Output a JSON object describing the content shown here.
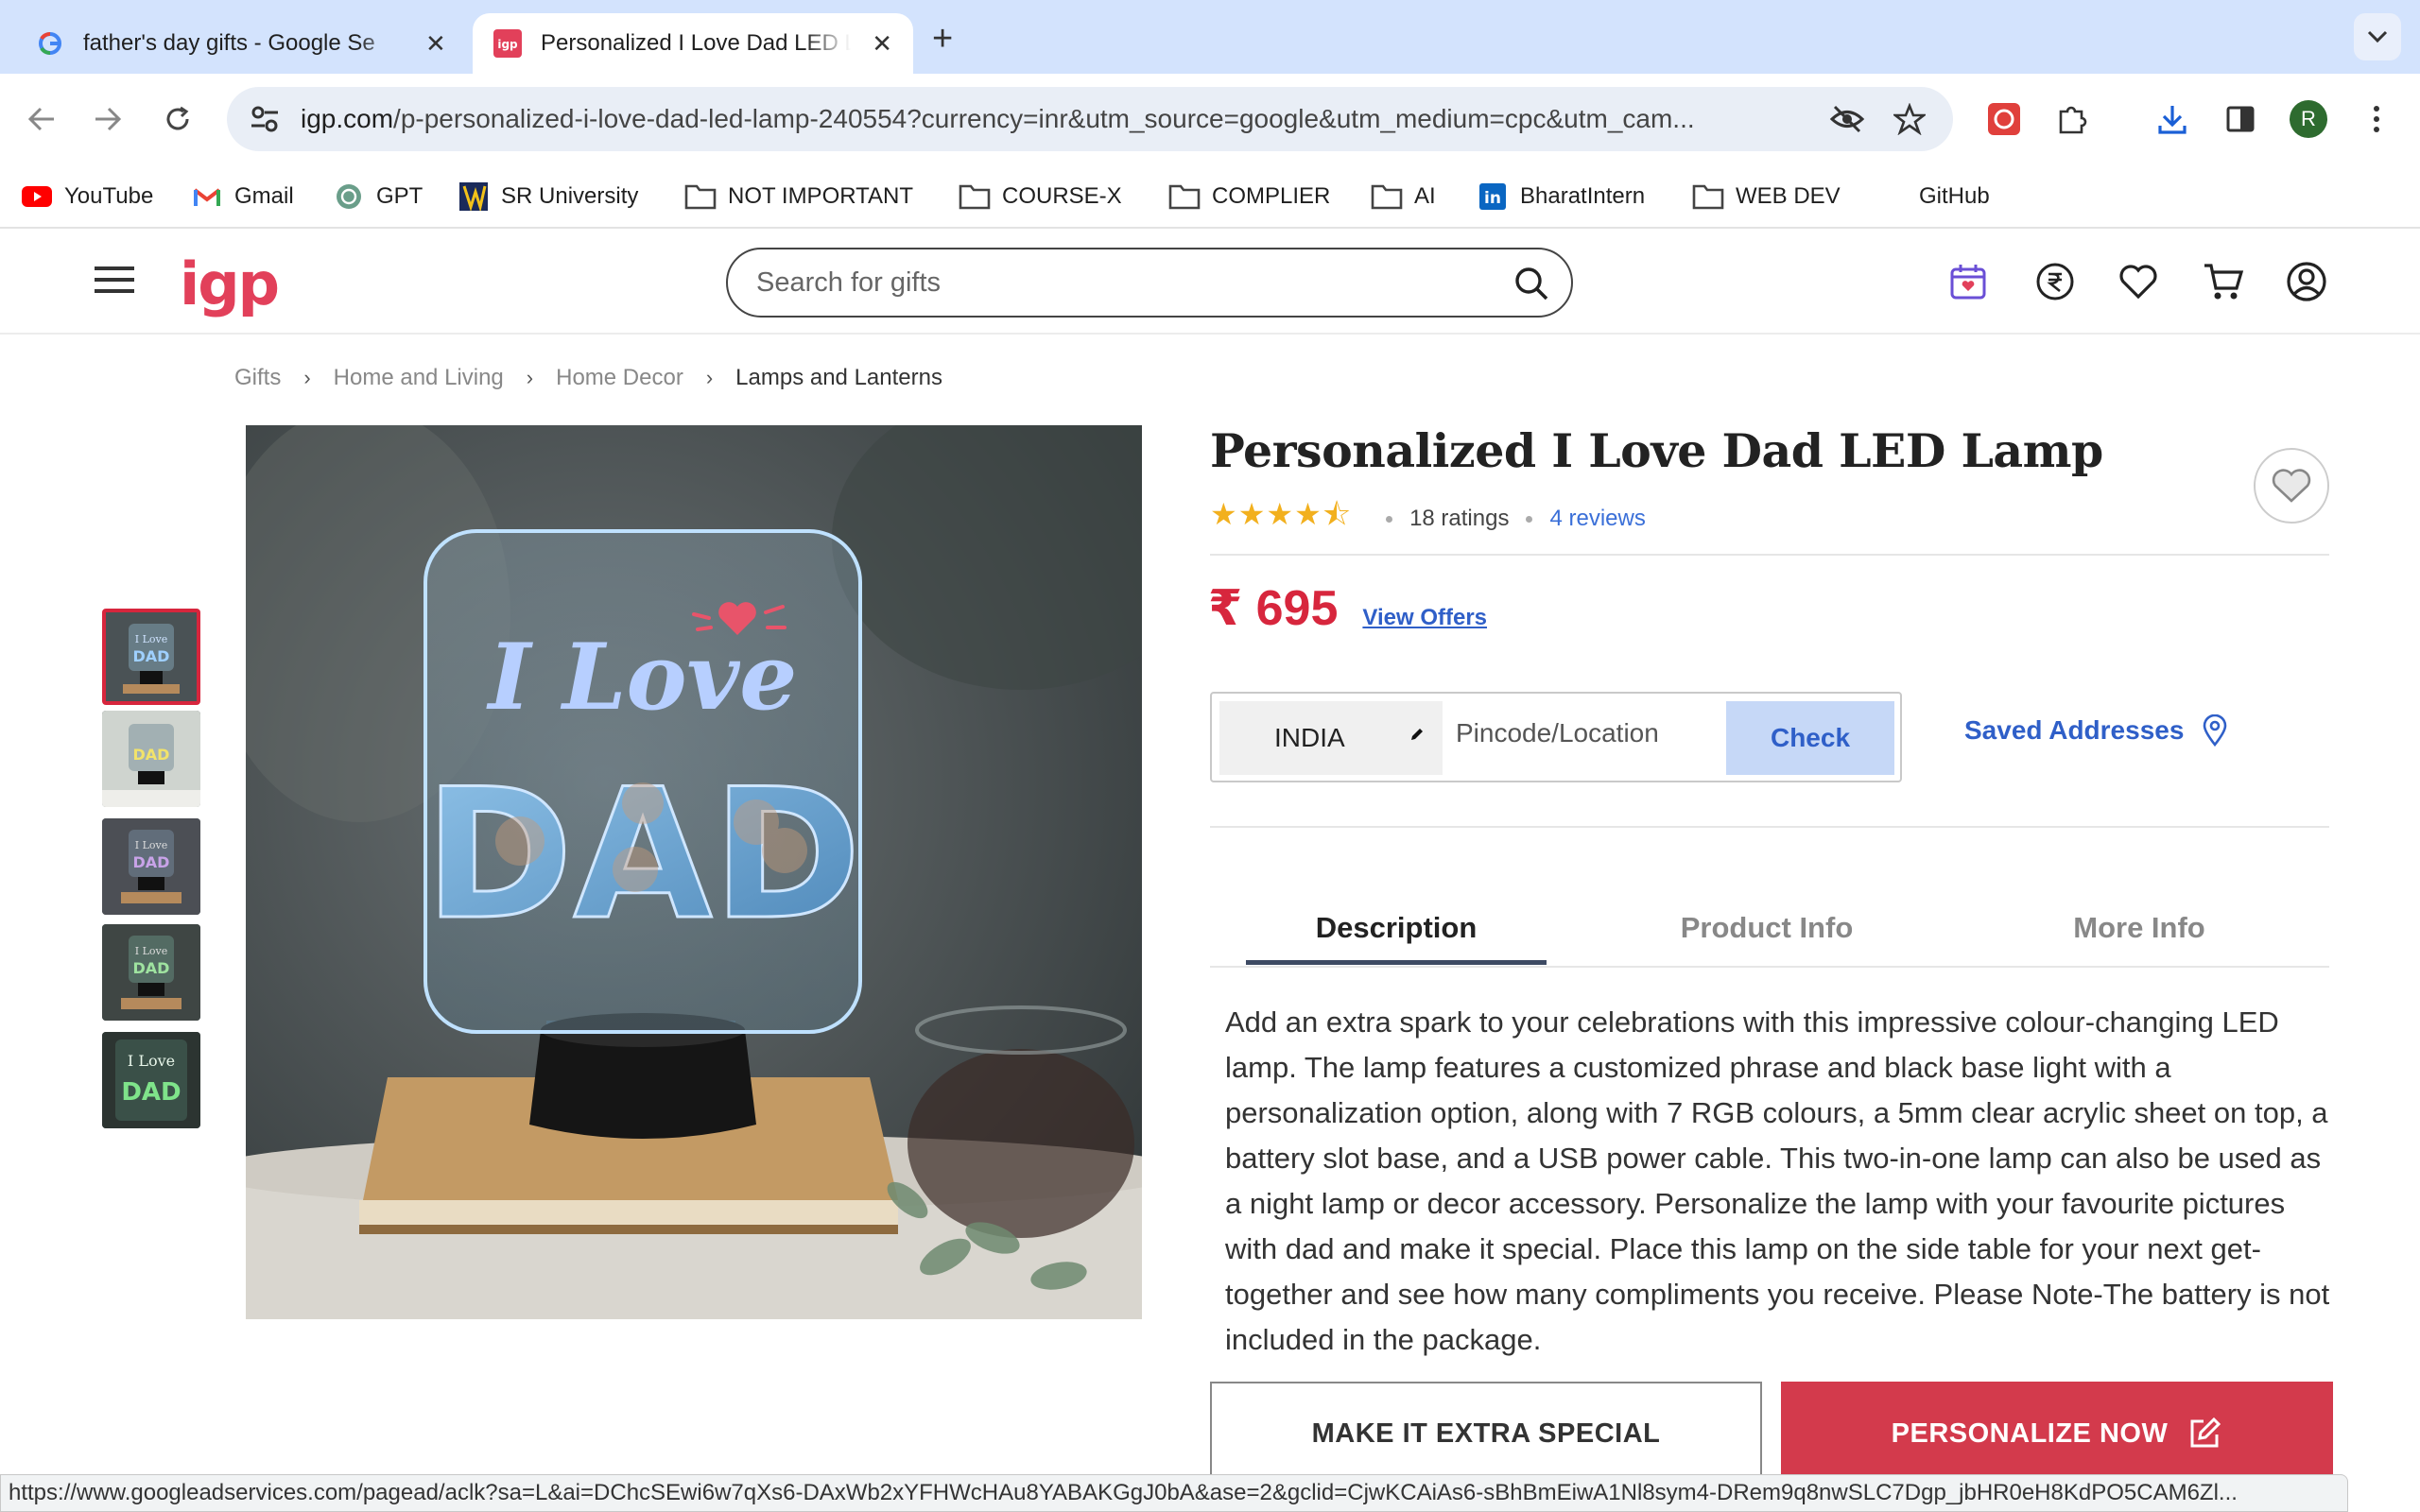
{
  "browser": {
    "tabs": [
      {
        "title": "father's day gifts - Google Se",
        "active": false
      },
      {
        "title": "Personalized I Love Dad LED L",
        "active": true
      }
    ],
    "url_host": "igp.com",
    "url_path": "/p-personalized-i-love-dad-led-lamp-240554?currency=inr&utm_source=google&utm_medium=cpc&utm_cam...",
    "profile_initial": "R",
    "bookmarks": [
      "YouTube",
      "Gmail",
      "GPT",
      "SR University",
      "NOT IMPORTANT",
      "COURSE-X",
      "COMPLIER",
      "AI",
      "BharatIntern",
      "WEB DEV",
      "GitHub"
    ],
    "status_url": "https://www.googleadservices.com/pagead/aclk?sa=L&ai=DChcSEwi6w7qXs6-DAxWb2xYFHWcHAu8YABAKGgJ0bA&ase=2&gclid=CjwKCAiAs6-sBhBmEiwA1Nl8sym4-DRem9q8nwSLC7Dgp_jbHR0eH8KdPO5CAM6Zl..."
  },
  "site": {
    "logo": "igp",
    "search_placeholder": "Search for gifts",
    "brand_color": "#e2405a"
  },
  "breadcrumb": [
    "Gifts",
    "Home and Living",
    "Home Decor",
    "Lamps and Lanterns"
  ],
  "product": {
    "title": "Personalized I Love Dad LED Lamp",
    "stars": "★★★★⯪",
    "ratings": "18 ratings",
    "reviews": "4 reviews",
    "price": "₹ 695",
    "view_offers": "View Offers",
    "country": "INDIA",
    "pincode_placeholder": "Pincode/Location",
    "check_label": "Check",
    "saved_addresses": "Saved Addresses",
    "tabs": [
      "Description",
      "Product Info",
      "More Info"
    ],
    "active_tab": "Description",
    "description": "Add an extra spark to your celebrations with this impressive colour-changing LED lamp. The lamp features a customized phrase and black base light with a personalization option, along with 7 RGB colours, a 5mm clear acrylic sheet on top, a battery slot base, and a USB power cable. This two-in-one lamp can also be used as a night lamp or decor accessory. Personalize the lamp with your favourite pictures with dad and make it special. Place this lamp on the side table for your next get-together and see how many compliments you receive. Please Note-The battery is not included in the package.",
    "lamp_text_line1": "I Love",
    "lamp_text_line2": "DAD",
    "btn_extra": "MAKE IT EXTRA SPECIAL",
    "btn_personalize": "PERSONALIZE NOW",
    "accent_color": "#d33a4c"
  }
}
